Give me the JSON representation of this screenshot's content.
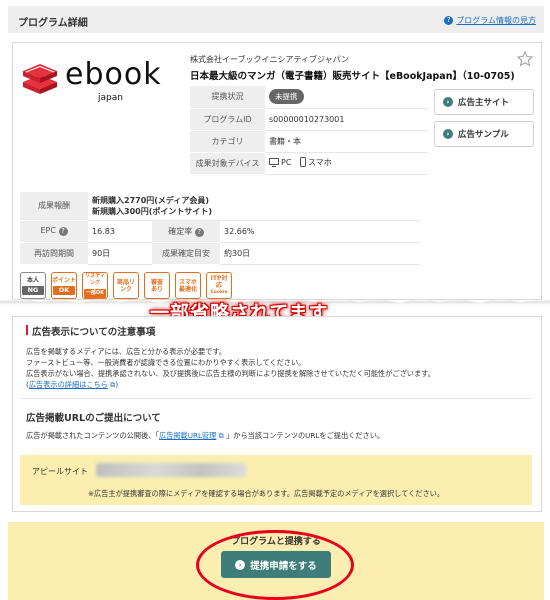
{
  "header": {
    "title": "プログラム詳細",
    "help_link": "プログラム情報の見方"
  },
  "logo": {
    "word": "ebook",
    "sub": "japan"
  },
  "program": {
    "company": "株式会社イーブックイニシアティブジャパン",
    "name": "日本最大級のマンガ（電子書籍）販売サイト【eBookJapan】（10-0705)",
    "status_label": "提携状況",
    "status_value": "未提携",
    "id_label": "プログラムID",
    "id_value": "s00000010273001",
    "category_label": "カテゴリ",
    "category_value": "書籍・本",
    "device_label": "成果対象デバイス",
    "device_pc": "PC",
    "device_sp": "スマホ"
  },
  "side_buttons": {
    "advertiser_site": "広告主サイト",
    "ad_sample": "広告サンプル"
  },
  "reward": {
    "reward_label": "成果報酬",
    "reward_line1": "新規購入2770円(メディア会員)",
    "reward_line2": "新規購入300円(ポイントサイト)",
    "epc_label": "EPC",
    "epc_value": "16.83",
    "confirm_rate_label": "確定率",
    "confirm_rate_value": "32.66%",
    "revisit_label": "再訪問期間",
    "revisit_value": "90日",
    "confirm_period_label": "成果確定目安",
    "confirm_period_value": "約30日"
  },
  "tags": [
    {
      "top": "本人",
      "bottom": "NG"
    },
    {
      "top": "ポイント",
      "bottom": "OK"
    },
    {
      "top": "リスティング",
      "bottom": "一部OK"
    },
    {
      "top": "商品リンク",
      "bottom": ""
    },
    {
      "top": "審査あり",
      "bottom": ""
    },
    {
      "top": "スマホ最適化",
      "bottom": ""
    },
    {
      "top": "ITP対応",
      "bottom": "Cookie"
    }
  ],
  "overlay": {
    "omitted": "一部省略されてます"
  },
  "ad_notice": {
    "title": "広告表示についての注意事項",
    "line1": "広告を掲載するメディアには、広告と分かる表示が必要です。",
    "line2": "ファーストビュー等、一般消費者が認識できる位置にわかりやすく表示してください。",
    "line3": "広告表示がない場合、提携承認されない、及び提携後に広告主様の判断により提携を解除させていただく可能性がございます。",
    "detail_link": "広告表示の詳細はこちら"
  },
  "url_submit": {
    "title": "広告掲載URLのご提出について",
    "text_before": "広告が掲載されたコンテンツの公開後、「",
    "link": "広告掲載URL管理",
    "text_after": "」から当該コンテンツのURLをご提出ください。",
    "appeal_label": "アピールサイト",
    "note": "※広告主が提携審査の際にメディアを確認する場合があります。広告掲載予定のメディアを選択してください。"
  },
  "footer": {
    "caption": "プログラムと提携する",
    "apply_button": "提携申請をする"
  },
  "colors": {
    "accent": "#3f7d7a",
    "tag_orange": "#e36f1e",
    "highlight_red": "#e8001a",
    "yellow_panel": "#fbeeb0"
  }
}
